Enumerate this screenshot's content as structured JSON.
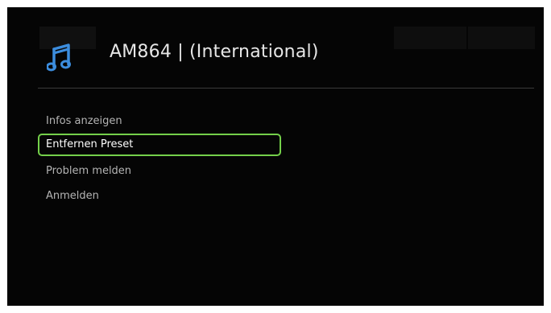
{
  "header": {
    "title": "AM864 | (International)",
    "icon": "music-note-icon",
    "icon_color": "#3c8dde"
  },
  "menu": {
    "selected_index": 1,
    "highlight_color": "#74d04a",
    "items": [
      {
        "label": "Infos anzeigen"
      },
      {
        "label": "Entfernen Preset"
      },
      {
        "label": "Problem melden"
      },
      {
        "label": "Anmelden"
      }
    ]
  }
}
